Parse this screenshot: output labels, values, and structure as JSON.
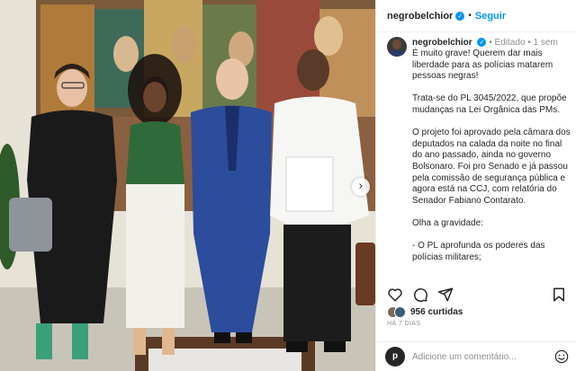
{
  "post": {
    "username": "negrobelchior",
    "follow_label": "Seguir",
    "verified_glyph": "✓",
    "separator": "•",
    "edited_label": "Editado",
    "age": "1 sem"
  },
  "caption": {
    "paragraphs": [
      "É muito grave! Querem dar mais liberdade para as polícias matarem pessoas negras!",
      "Trata-se do PL 3045/2022, que propõe mudanças na Lei Orgânica das PMs.",
      "O projeto foi aprovado pela câmara dos deputados na calada da noite no final do ano passado, ainda no governo Bolsonaro. Foi pro Senado e já passou pela comissão de segurança pública e agora está na CCJ, com relatória do Senador Fabiano Contarato.",
      "Olha a gravidade:",
      "- O PL aprofunda os poderes das polícias militares;"
    ]
  },
  "actions": {
    "icons": [
      "heart-icon",
      "comment-icon",
      "share-icon",
      "bookmark-icon"
    ]
  },
  "likes": {
    "text": "956 curtidas"
  },
  "time_ago": "HÁ 7 DIAS",
  "comment_box": {
    "avatar_letter": "p",
    "placeholder": "Adicione um comentário..."
  },
  "carousel": {
    "next_glyph": "›"
  },
  "colors": {
    "accent": "#0095f6",
    "text": "#262626",
    "muted": "#8e8e8e",
    "border": "#efefef"
  }
}
